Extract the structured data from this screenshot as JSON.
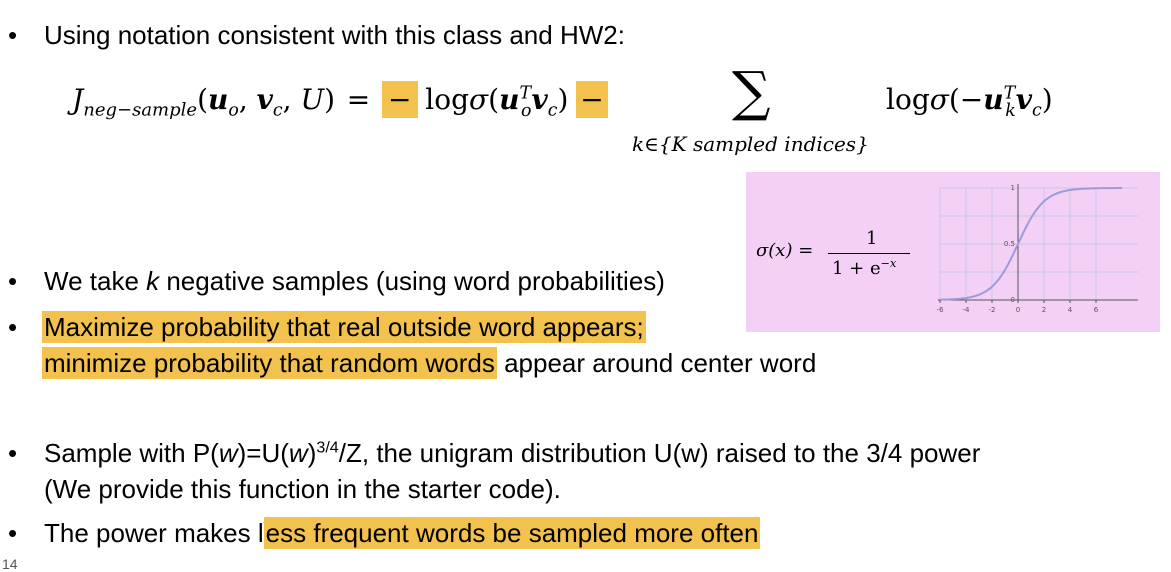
{
  "bullets": {
    "intro": "Using notation consistent with this class and HW2:",
    "k_prefix": "We take ",
    "k_var": "k",
    "k_suffix": " negative samples (using word probabilities)",
    "maximize_hl": "Maximize probability that real outside word appears;",
    "minimize_hl": "minimize probability that random words",
    "minimize_rest": " appear around center word",
    "sample_prefix": "Sample with P(",
    "sample_w1": "w",
    "sample_mid1": ")=U(",
    "sample_w2": "w",
    "sample_mid2": ")",
    "sample_exp": "3/4",
    "sample_suffix": "/Z, the unigram distribution U(w) raised to the 3/4 power",
    "sample_line2": "(We provide this function in the starter code).",
    "power_prefix": "The power makes l",
    "power_hl": "ess frequent words be sampled more often"
  },
  "formula": {
    "J": "J",
    "J_sub": "neg−sample",
    "args_open": "(",
    "u": "u",
    "u_sub": "o",
    "comma1": ", ",
    "v": "v",
    "v_sub": "c",
    "comma2": ", ",
    "U": "U",
    "args_close": ")",
    "equals": "=",
    "minus1": "−",
    "log1": "log",
    "sigma1": "σ",
    "p_open1": "(",
    "uT_sup": "T",
    "uT_sub": "o",
    "v1_sub": "c",
    "p_close1": ")",
    "minus2": "−",
    "sum": "∑",
    "sum_sub": "k∈{K sampled indices}",
    "log2": "log",
    "sigma2": "σ",
    "p_open2": "(−",
    "u2_sup": "T",
    "u2_sub": "k",
    "v2_sub": "c",
    "p_close2": ")"
  },
  "sigmoid": {
    "lhs": "σ(x) =",
    "numerator": "1",
    "denominator": "1 + e",
    "den_exp": "−x",
    "x_ticks": [
      "-6",
      "-4",
      "-2",
      "0",
      "2",
      "4",
      "6"
    ],
    "y_ticks": [
      "1",
      "0.5",
      "0"
    ],
    "curve_color": "#9a9bd8",
    "bg_color": "#f4d0f6"
  },
  "page_number": "14",
  "colors": {
    "highlight": "#f2c14e"
  }
}
